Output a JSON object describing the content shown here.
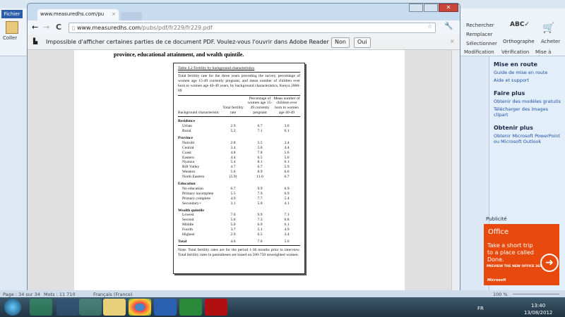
{
  "word": {
    "file_tab": "Fichier",
    "paste": "Coller",
    "ribbon": {
      "find": "Rechercher",
      "replace": "Remplacer",
      "select": "Sélectionner",
      "group_edit": "Modification",
      "spelling": "Orthographe",
      "group_review": "Vérification",
      "buy": "Acheter",
      "group_upgrade": "Mise à nive..."
    },
    "pane": {
      "sections": [
        {
          "title": "Mise en route",
          "links": [
            "Guide de mise en route",
            "Aide et support"
          ]
        },
        {
          "title": "Faire plus",
          "links": [
            "Obtenir des modèles gratuits",
            "Télécharger des images clipart"
          ]
        },
        {
          "title": "Obtenir plus",
          "links": [
            "Obtenir Microsoft PowerPoint ou Microsoft Outlook"
          ]
        }
      ],
      "ad_label": "Publicité",
      "ad_brand": "Office",
      "ad_text": "Take a short trip to a place called Done.",
      "ad_cta": "PREVIEW THE NEW OFFICE 365",
      "ad_footer": "Microsoft",
      "ad_color": "#e84a0d"
    },
    "status": {
      "page": "Page : 34 sur 34",
      "words": "Mots : 11 710",
      "language": "Français (France)",
      "zoom": "100 %"
    }
  },
  "taskbar": {
    "lang": "FR",
    "time": "13:40",
    "date": "13/08/2012"
  },
  "chrome": {
    "tab_title": "www.measuredhs.com/pu",
    "url_domain": "www.measuredhs.com",
    "url_path": "/pubs/pdf/fr229/fr229.pdf",
    "infobar": {
      "message": "Impossible d'afficher certaines parties de ce document PDF. Voulez-vous l'ouvrir dans Adobe Reader ?",
      "no": "Non",
      "yes": "Oui"
    }
  },
  "pdf": {
    "heading_fragment": "province, educational attainment, and wealth quintile.",
    "table": {
      "title": "Table 4.2  Fertility by background characteristics",
      "caption": "Total fertility rate for the three years preceding the survey, percentage of women age 15-49 currently pregnant, and mean number of children ever born to women age 40-49 years, by background characteristics, Kenya 2008-09",
      "headers": [
        "Background characteristic",
        "Total fertility rate",
        "Percentage of women age 15-49 currently pregnant",
        "Mean number of children ever born to women age 40-49"
      ],
      "sections": [
        {
          "name": "Residence",
          "rows": [
            [
              "Urban",
              "2.9",
              "6.7",
              "3.6"
            ],
            [
              "Rural",
              "5.2",
              "7.1",
              "6.1"
            ]
          ]
        },
        {
          "name": "Province",
          "rows": [
            [
              "Nairobi",
              "2.8",
              "5.5",
              "3.4"
            ],
            [
              "Central",
              "3.4",
              "5.0",
              "4.4"
            ],
            [
              "Coast",
              "4.8",
              "7.8",
              "5.6"
            ],
            [
              "Eastern",
              "4.4",
              "6.5",
              "5.6"
            ],
            [
              "Nyanza",
              "5.4",
              "8.1",
              "6.1"
            ],
            [
              "Rift Valley",
              "4.7",
              "6.7",
              "5.9"
            ],
            [
              "Western",
              "5.6",
              "8.9",
              "6.6"
            ],
            [
              "North Eastern",
              "(5.9)",
              "11.0",
              "6.7"
            ]
          ]
        },
        {
          "name": "Education",
          "rows": [
            [
              "No education",
              "6.7",
              "9.9",
              "6.9"
            ],
            [
              "Primary incomplete",
              "5.5",
              "7.9",
              "6.9"
            ],
            [
              "Primary complete",
              "4.9",
              "7.7",
              "5.4"
            ],
            [
              "Secondary+",
              "3.1",
              "5.0",
              "4.1"
            ]
          ]
        },
        {
          "name": "Wealth quintile",
          "rows": [
            [
              "Lowest",
              "7.0",
              "9.9",
              "7.1"
            ],
            [
              "Second",
              "5.6",
              "7.3",
              "6.8"
            ],
            [
              "Middle",
              "5.0",
              "6.9",
              "6.1"
            ],
            [
              "Fourth",
              "3.7",
              "5.1",
              "4.9"
            ],
            [
              "Highest",
              "2.9",
              "6.5",
              "3.4"
            ]
          ]
        }
      ],
      "total": [
        "Total",
        "4.6",
        "7.0",
        "5.6"
      ],
      "note": "Note: Total fertility rates are for the period 1-36 months prior to interview. Total fertility rates in parentheses are based on 500-750 unweighted women."
    }
  }
}
